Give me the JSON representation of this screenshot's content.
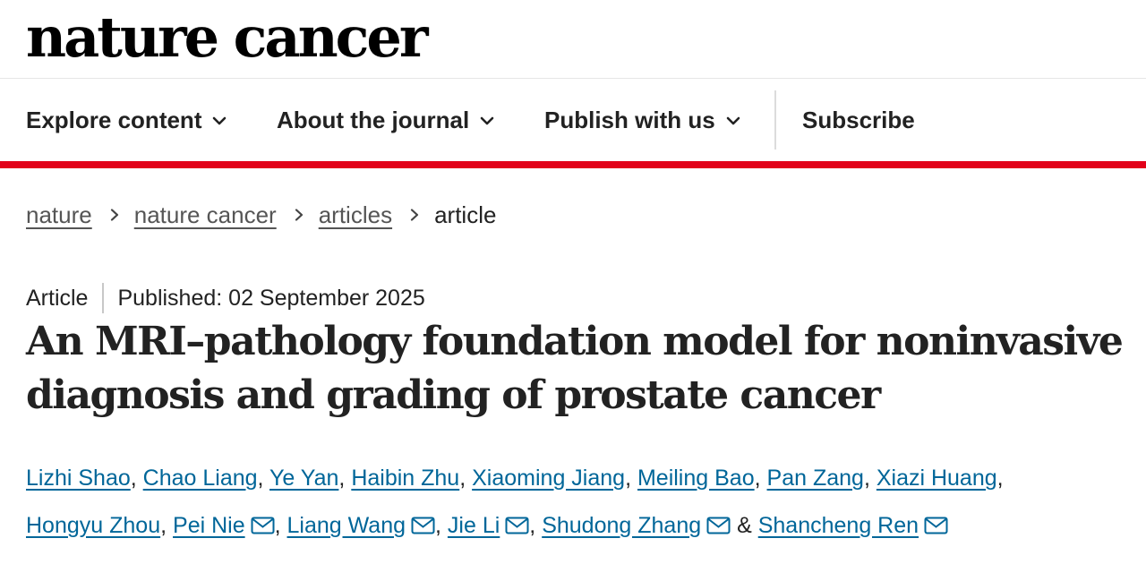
{
  "site": {
    "logo": "nature cancer"
  },
  "nav": {
    "items": [
      {
        "label": "Explore content",
        "icon": "chevron-down-icon"
      },
      {
        "label": "About the journal",
        "icon": "chevron-down-icon"
      },
      {
        "label": "Publish with us",
        "icon": "chevron-down-icon"
      }
    ],
    "subscribe": "Subscribe"
  },
  "colors": {
    "accent": "#e2001a",
    "link": "#006699",
    "text": "#222222"
  },
  "breadcrumb": {
    "items": [
      "nature",
      "nature cancer",
      "articles"
    ],
    "current": "article"
  },
  "article": {
    "type": "Article",
    "published": "Published: 02 September 2025",
    "title": "An MRI–pathology foundation model for noninvasive diagnosis and grading of prostate cancer",
    "authors": [
      "Lizhi Shao",
      "Chao Liang",
      "Ye Yan",
      "Haibin Zhu",
      "Xiaoming Jiang",
      "Meiling Bao",
      "Pan Zang",
      "Xiazi Huang",
      "Hongyu Zhou",
      "Pei Nie",
      "Liang Wang",
      "Jie Li",
      "Shudong Zhang",
      "Shancheng Ren"
    ],
    "author_separator": ", ",
    "author_final_separator": " & ",
    "trailing_comma": ","
  }
}
